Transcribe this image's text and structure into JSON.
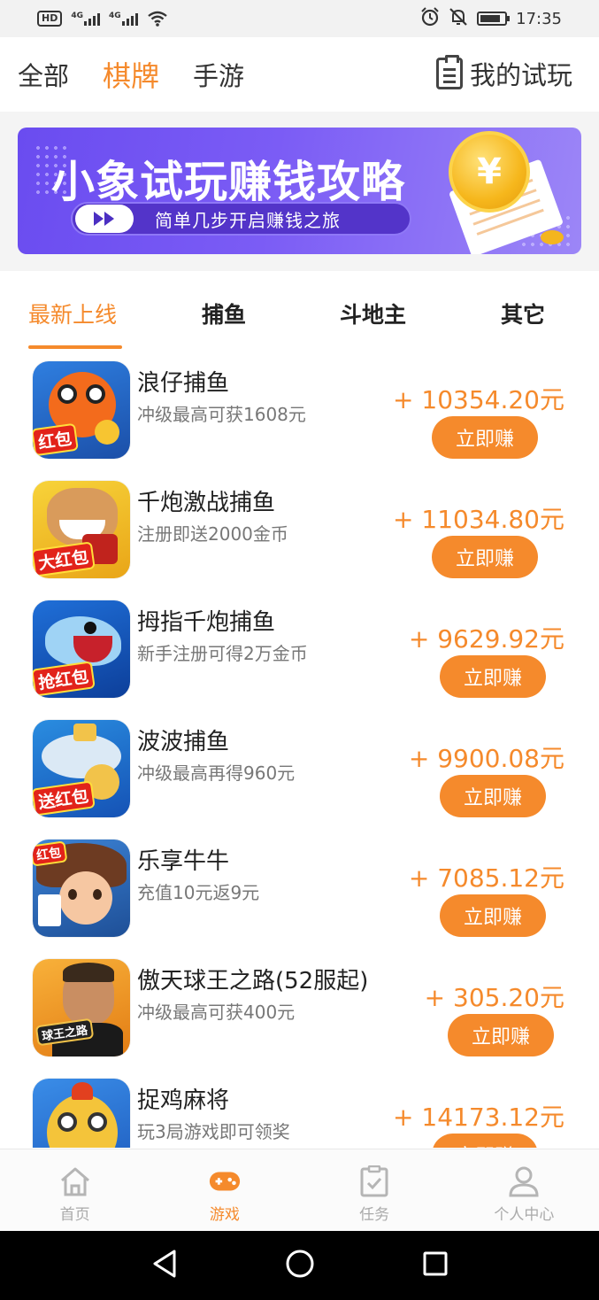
{
  "status_bar": {
    "hd": "HD",
    "signal1": "4G",
    "signal2": "4G",
    "time": "17:35"
  },
  "top_nav": {
    "tabs": [
      {
        "label": "全部",
        "active": false
      },
      {
        "label": "棋牌",
        "active": true
      },
      {
        "label": "手游",
        "active": false
      }
    ],
    "my_trial_label": "我的试玩"
  },
  "banner": {
    "title": "小象试玩赚钱攻略",
    "subtitle": "简单几步开启赚钱之旅",
    "coin_symbol": "¥"
  },
  "category_tabs": [
    {
      "label": "最新上线",
      "active": true
    },
    {
      "label": "捕鱼",
      "active": false
    },
    {
      "label": "斗地主",
      "active": false
    },
    {
      "label": "其它",
      "active": false
    }
  ],
  "games": [
    {
      "name": "浪仔捕鱼",
      "desc": "冲级最高可获1608元",
      "reward": "+ 10354.20元",
      "button": "立即赚",
      "badge": "红包",
      "icon_colors": [
        "#2f7fe0",
        "#f36b1c"
      ]
    },
    {
      "name": "千炮激战捕鱼",
      "desc": "注册即送2000金币",
      "reward": "+ 11034.80元",
      "button": "立即赚",
      "badge": "大红包",
      "icon_colors": [
        "#f4c21b",
        "#c0231d"
      ]
    },
    {
      "name": "拇指千炮捕鱼",
      "desc": "新手注册可得2万金币",
      "reward": "+ 9629.92元",
      "button": "立即赚",
      "badge": "抢红包",
      "icon_colors": [
        "#1f6fd8",
        "#9fd3f5"
      ]
    },
    {
      "name": "波波捕鱼",
      "desc": "冲级最高再得960元",
      "reward": "+ 9900.08元",
      "button": "立即赚",
      "badge": "送红包",
      "icon_colors": [
        "#2a8de0",
        "#f2c34a"
      ]
    },
    {
      "name": "乐享牛牛",
      "desc": "充值10元返9元",
      "reward": "+ 7085.12元",
      "button": "立即赚",
      "badge": "红包",
      "icon_colors": [
        "#6d3b22",
        "#f6c7a2"
      ]
    },
    {
      "name": "傲天球王之路(52服起)",
      "desc": "冲级最高可获400元",
      "reward": "+ 305.20元",
      "button": "立即赚",
      "badge": "球王之路",
      "icon_colors": [
        "#f29b25",
        "#3a2a1c"
      ]
    },
    {
      "name": "捉鸡麻将",
      "desc": "玩3局游戏即可领奖",
      "reward": "+ 14173.12元",
      "button": "立即赚",
      "badge": "",
      "icon_colors": [
        "#3a8de8",
        "#f4c43a"
      ]
    }
  ],
  "bottom_nav": [
    {
      "label": "首页",
      "icon": "home-icon",
      "active": false
    },
    {
      "label": "游戏",
      "icon": "gamepad-icon",
      "active": true
    },
    {
      "label": "任务",
      "icon": "task-icon",
      "active": false
    },
    {
      "label": "个人中心",
      "icon": "person-icon",
      "active": false
    }
  ],
  "colors": {
    "accent": "#f58a2c",
    "banner_purple": "#6a4cf0",
    "text_secondary": "#777777"
  }
}
